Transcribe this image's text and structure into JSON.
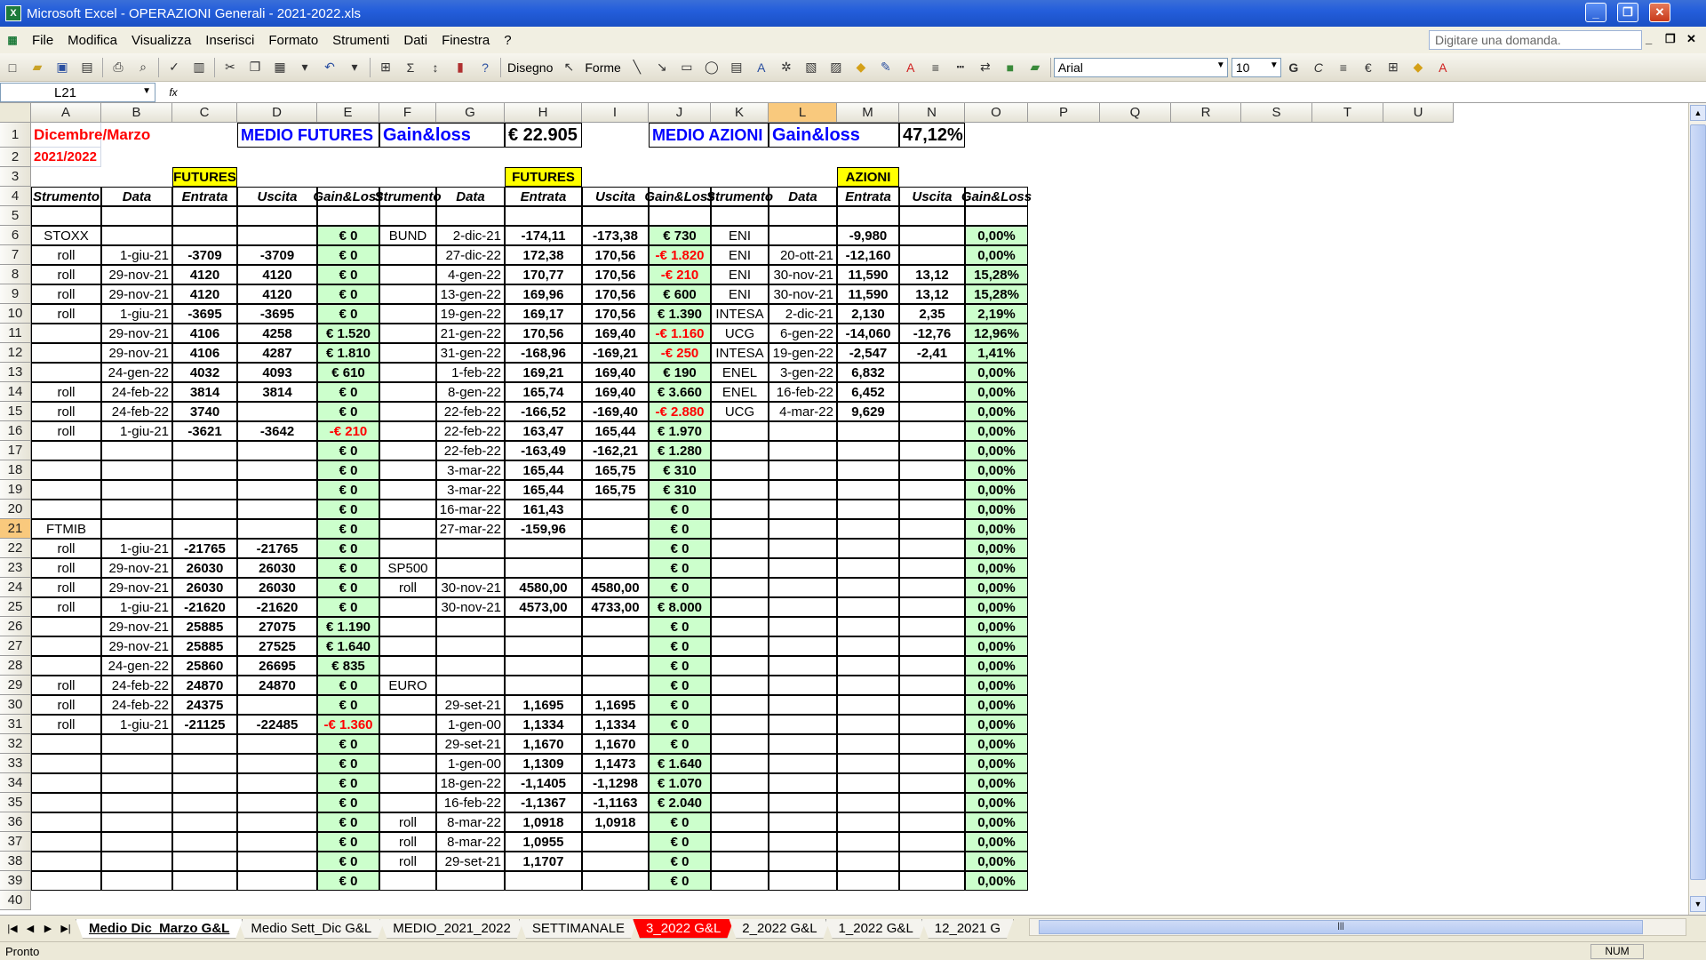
{
  "window": {
    "title": "Microsoft Excel - OPERAZIONI Generali - 2021-2022.xls",
    "logo_letter": "X",
    "min_label": "_",
    "max_label": "❐",
    "close_label": "✕"
  },
  "menu": {
    "items": [
      "File",
      "Modifica",
      "Visualizza",
      "Inserisci",
      "Formato",
      "Strumenti",
      "Dati",
      "Finestra",
      "?"
    ],
    "help_placeholder": "Digitare una domanda.",
    "doc_min": "_",
    "doc_restore": "❐",
    "doc_close": "✕"
  },
  "toolbar": {
    "draw_label": "Disegno",
    "shapes_label": "Forme",
    "font_name": "Arial",
    "font_size": "10",
    "bold": "G",
    "italic": "C",
    "euro": "€"
  },
  "formula": {
    "cell_ref": "L21",
    "fx": "fx",
    "content": ""
  },
  "columns": [
    "A",
    "B",
    "C",
    "D",
    "E",
    "F",
    "G",
    "H",
    "I",
    "J",
    "K",
    "L",
    "M",
    "N",
    "O",
    "P",
    "Q",
    "R",
    "S",
    "T",
    "U"
  ],
  "selected": {
    "col": "L",
    "row": 21
  },
  "cells": [
    {
      "r": 1,
      "c": "A",
      "t": "Dicembre/Marzo",
      "s": "l b red big16"
    },
    {
      "r": 1,
      "c": "D",
      "span": 2,
      "t": "MEDIO FUTURES",
      "s": "l b blu big18 bx"
    },
    {
      "r": 1,
      "c": "F",
      "span": 2,
      "t": "Gain&loss",
      "s": "l b blu big20 bx"
    },
    {
      "r": 1,
      "c": "H",
      "t": "€ 22.905",
      "s": "l b big20 bx"
    },
    {
      "r": 1,
      "c": "J",
      "span": 2,
      "t": "MEDIO AZIONI",
      "s": "l b blu big18 bx"
    },
    {
      "r": 1,
      "c": "L",
      "span": 2,
      "t": "Gain&loss",
      "s": "l b blu big20 bx"
    },
    {
      "r": 1,
      "c": "N",
      "t": "47,12%",
      "s": "l b big20 bx"
    },
    {
      "r": 2,
      "c": "A",
      "t": "2021/2022",
      "s": "l b red"
    },
    {
      "r": 3,
      "c": "C",
      "t": "FUTURES",
      "s": "m b yel bx"
    },
    {
      "r": 3,
      "c": "H",
      "t": "FUTURES",
      "s": "m b yel bx"
    },
    {
      "r": 3,
      "c": "M",
      "t": "AZIONI",
      "s": "m b yel bx"
    },
    {
      "r": 4,
      "c": "A",
      "t": "Strumento",
      "s": "m b i bx"
    },
    {
      "r": 4,
      "c": "B",
      "t": "Data",
      "s": "m b i bx"
    },
    {
      "r": 4,
      "c": "C",
      "t": "Entrata",
      "s": "m b i bx"
    },
    {
      "r": 4,
      "c": "D",
      "t": "Uscita",
      "s": "m b i bx"
    },
    {
      "r": 4,
      "c": "E",
      "t": "Gain&Loss",
      "s": "m b i bx"
    },
    {
      "r": 4,
      "c": "F",
      "t": "Strumento",
      "s": "m b i bx"
    },
    {
      "r": 4,
      "c": "G",
      "t": "Data",
      "s": "m b i bx"
    },
    {
      "r": 4,
      "c": "H",
      "t": "Entrata",
      "s": "m b i bx"
    },
    {
      "r": 4,
      "c": "I",
      "t": "Uscita",
      "s": "m b i bx"
    },
    {
      "r": 4,
      "c": "J",
      "t": "Gain&Loss",
      "s": "m b i bx"
    },
    {
      "r": 4,
      "c": "K",
      "t": "Strumento",
      "s": "m b i bx"
    },
    {
      "r": 4,
      "c": "L",
      "t": "Data",
      "s": "m b i bx"
    },
    {
      "r": 4,
      "c": "M",
      "t": "Entrata",
      "s": "m b i bx"
    },
    {
      "r": 4,
      "c": "N",
      "t": "Uscita",
      "s": "m b i bx"
    },
    {
      "r": 4,
      "c": "O",
      "t": "Gain&Loss",
      "s": "m b i bx"
    }
  ],
  "rows": [
    {
      "r": 6,
      "A": "STOXX",
      "E": "€ 0",
      "F": "BUND",
      "G": "2-dic-21",
      "H": "-174,11",
      "I": "-173,38",
      "J": "€ 730",
      "K": "ENI",
      "M": "-9,980",
      "O": "0,00%"
    },
    {
      "r": 7,
      "A": "roll",
      "B": "1-giu-21",
      "C": "-3709",
      "D": "-3709",
      "E": "€ 0",
      "G": "27-dic-22",
      "H": "172,38",
      "I": "170,56",
      "J": "-€ 1.820",
      "Jred": true,
      "K": "ENI",
      "L": "20-ott-21",
      "M": "-12,160",
      "O": "0,00%"
    },
    {
      "r": 8,
      "A": "roll",
      "B": "29-nov-21",
      "C": "4120",
      "D": "4120",
      "E": "€ 0",
      "G": "4-gen-22",
      "H": "170,77",
      "I": "170,56",
      "J": "-€ 210",
      "Jred": true,
      "K": "ENI",
      "L": "30-nov-21",
      "M": "11,590",
      "N": "13,12",
      "O": "15,28%"
    },
    {
      "r": 9,
      "A": "roll",
      "B": "29-nov-21",
      "C": "4120",
      "D": "4120",
      "E": "€ 0",
      "G": "13-gen-22",
      "H": "169,96",
      "I": "170,56",
      "J": "€ 600",
      "K": "ENI",
      "L": "30-nov-21",
      "M": "11,590",
      "N": "13,12",
      "O": "15,28%"
    },
    {
      "r": 10,
      "A": "roll",
      "B": "1-giu-21",
      "C": "-3695",
      "D": "-3695",
      "E": "€ 0",
      "G": "19-gen-22",
      "H": "169,17",
      "I": "170,56",
      "J": "€ 1.390",
      "K": "INTESA",
      "L": "2-dic-21",
      "M": "2,130",
      "N": "2,35",
      "O": "2,19%"
    },
    {
      "r": 11,
      "B": "29-nov-21",
      "C": "4106",
      "D": "4258",
      "E": "€ 1.520",
      "G": "21-gen-22",
      "H": "170,56",
      "I": "169,40",
      "J": "-€ 1.160",
      "Jred": true,
      "K": "UCG",
      "L": "6-gen-22",
      "M": "-14,060",
      "N": "-12,76",
      "O": "12,96%"
    },
    {
      "r": 12,
      "B": "29-nov-21",
      "C": "4106",
      "D": "4287",
      "E": "€ 1.810",
      "G": "31-gen-22",
      "H": "-168,96",
      "I": "-169,21",
      "J": "-€ 250",
      "Jred": true,
      "K": "INTESA",
      "L": "19-gen-22",
      "M": "-2,547",
      "N": "-2,41",
      "O": "1,41%"
    },
    {
      "r": 13,
      "B": "24-gen-22",
      "C": "4032",
      "D": "4093",
      "E": "€ 610",
      "G": "1-feb-22",
      "H": "169,21",
      "I": "169,40",
      "J": "€ 190",
      "K": "ENEL",
      "L": "3-gen-22",
      "M": "6,832",
      "O": "0,00%"
    },
    {
      "r": 14,
      "A": "roll",
      "B": "24-feb-22",
      "C": "3814",
      "D": "3814",
      "E": "€ 0",
      "G": "8-gen-22",
      "H": "165,74",
      "I": "169,40",
      "J": "€ 3.660",
      "K": "ENEL",
      "L": "16-feb-22",
      "M": "6,452",
      "O": "0,00%"
    },
    {
      "r": 15,
      "A": "roll",
      "B": "24-feb-22",
      "C": "3740",
      "E": "€ 0",
      "G": "22-feb-22",
      "H": "-166,52",
      "I": "-169,40",
      "J": "-€ 2.880",
      "Jred": true,
      "K": "UCG",
      "L": "4-mar-22",
      "M": "9,629",
      "O": "0,00%"
    },
    {
      "r": 16,
      "A": "roll",
      "B": "1-giu-21",
      "C": "-3621",
      "D": "-3642",
      "E": "-€ 210",
      "Ered": true,
      "G": "22-feb-22",
      "H": "163,47",
      "I": "165,44",
      "J": "€ 1.970",
      "O": "0,00%"
    },
    {
      "r": 17,
      "E": "€ 0",
      "G": "22-feb-22",
      "H": "-163,49",
      "I": "-162,21",
      "J": "€ 1.280",
      "O": "0,00%"
    },
    {
      "r": 18,
      "E": "€ 0",
      "G": "3-mar-22",
      "H": "165,44",
      "I": "165,75",
      "J": "€ 310",
      "O": "0,00%"
    },
    {
      "r": 19,
      "E": "€ 0",
      "G": "3-mar-22",
      "H": "165,44",
      "I": "165,75",
      "J": "€ 310",
      "O": "0,00%"
    },
    {
      "r": 20,
      "E": "€ 0",
      "G": "16-mar-22",
      "H": "161,43",
      "J": "€ 0",
      "O": "0,00%"
    },
    {
      "r": 21,
      "A": "FTMIB",
      "E": "€ 0",
      "G": "27-mar-22",
      "H": "-159,96",
      "J": "€ 0",
      "O": "0,00%"
    },
    {
      "r": 22,
      "A": "roll",
      "B": "1-giu-21",
      "C": "-21765",
      "D": "-21765",
      "E": "€ 0",
      "J": "€ 0",
      "O": "0,00%"
    },
    {
      "r": 23,
      "A": "roll",
      "B": "29-nov-21",
      "C": "26030",
      "D": "26030",
      "E": "€ 0",
      "F": "SP500",
      "J": "€ 0",
      "O": "0,00%"
    },
    {
      "r": 24,
      "A": "roll",
      "B": "29-nov-21",
      "C": "26030",
      "D": "26030",
      "E": "€ 0",
      "F": "roll",
      "G": "30-nov-21",
      "H": "4580,00",
      "I": "4580,00",
      "J": "€ 0",
      "O": "0,00%"
    },
    {
      "r": 25,
      "A": "roll",
      "B": "1-giu-21",
      "C": "-21620",
      "D": "-21620",
      "E": "€ 0",
      "G": "30-nov-21",
      "H": "4573,00",
      "I": "4733,00",
      "J": "€ 8.000",
      "O": "0,00%"
    },
    {
      "r": 26,
      "B": "29-nov-21",
      "C": "25885",
      "D": "27075",
      "E": "€ 1.190",
      "J": "€ 0",
      "O": "0,00%"
    },
    {
      "r": 27,
      "B": "29-nov-21",
      "C": "25885",
      "D": "27525",
      "E": "€ 1.640",
      "J": "€ 0",
      "O": "0,00%"
    },
    {
      "r": 28,
      "B": "24-gen-22",
      "C": "25860",
      "D": "26695",
      "E": "€ 835",
      "J": "€ 0",
      "O": "0,00%"
    },
    {
      "r": 29,
      "A": "roll",
      "B": "24-feb-22",
      "C": "24870",
      "D": "24870",
      "E": "€ 0",
      "F": "EURO",
      "J": "€ 0",
      "O": "0,00%"
    },
    {
      "r": 30,
      "A": "roll",
      "B": "24-feb-22",
      "C": "24375",
      "E": "€ 0",
      "G": "29-set-21",
      "H": "1,1695",
      "I": "1,1695",
      "J": "€ 0",
      "O": "0,00%"
    },
    {
      "r": 31,
      "A": "roll",
      "B": "1-giu-21",
      "C": "-21125",
      "D": "-22485",
      "E": "-€ 1.360",
      "Ered": true,
      "G": "1-gen-00",
      "H": "1,1334",
      "I": "1,1334",
      "J": "€ 0",
      "O": "0,00%"
    },
    {
      "r": 32,
      "E": "€ 0",
      "G": "29-set-21",
      "H": "1,1670",
      "I": "1,1670",
      "J": "€ 0",
      "O": "0,00%"
    },
    {
      "r": 33,
      "E": "€ 0",
      "G": "1-gen-00",
      "H": "1,1309",
      "I": "1,1473",
      "J": "€ 1.640",
      "O": "0,00%"
    },
    {
      "r": 34,
      "E": "€ 0",
      "G": "18-gen-22",
      "H": "-1,1405",
      "I": "-1,1298",
      "J": "€ 1.070",
      "O": "0,00%"
    },
    {
      "r": 35,
      "E": "€ 0",
      "G": "16-feb-22",
      "H": "-1,1367",
      "I": "-1,1163",
      "J": "€ 2.040",
      "O": "0,00%"
    },
    {
      "r": 36,
      "E": "€ 0",
      "F": "roll",
      "G": "8-mar-22",
      "H": "1,0918",
      "I": "1,0918",
      "J": "€ 0",
      "O": "0,00%"
    },
    {
      "r": 37,
      "E": "€ 0",
      "F": "roll",
      "G": "8-mar-22",
      "H": "1,0955",
      "J": "€ 0",
      "O": "0,00%"
    },
    {
      "r": 38,
      "E": "€ 0",
      "F": "roll",
      "G": "29-set-21",
      "H": "1,1707",
      "J": "€ 0",
      "O": "0,00%"
    },
    {
      "r": 39,
      "E": "€ 0",
      "J": "€ 0",
      "O": "0,00%"
    }
  ],
  "sheet_tabs": [
    {
      "label": "Medio Dic_Marzo G&L",
      "active": true
    },
    {
      "label": "Medio Sett_Dic G&L"
    },
    {
      "label": "MEDIO_2021_2022"
    },
    {
      "label": "SETTIMANALE"
    },
    {
      "label": "3_2022 G&L",
      "red": true
    },
    {
      "label": "2_2022 G&L"
    },
    {
      "label": "1_2022 G&L"
    },
    {
      "label": "12_2021 G"
    }
  ],
  "status": {
    "text": "Pronto",
    "num": "NUM"
  },
  "colors": {
    "green_fill": "#ccffcc",
    "header_yellow": "#ffff00",
    "negative": "#ff0000",
    "title_blue": "#0000ff"
  }
}
